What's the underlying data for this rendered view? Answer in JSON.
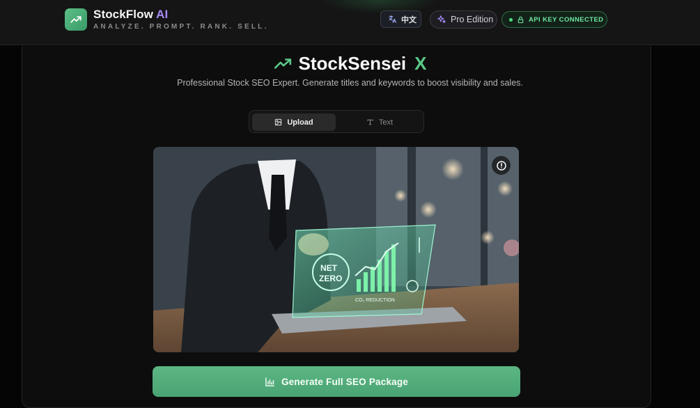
{
  "header": {
    "brand_name": "StockFlow",
    "brand_ai": "AI",
    "tagline": "ANALYZE. PROMPT. RANK. SELL.",
    "language_label": "中文",
    "edition_label": "Pro Edition",
    "api_status_label": "API KEY CONNECTED"
  },
  "main": {
    "title": "StockSensei",
    "title_suffix": "X",
    "subtitle": "Professional Stock SEO Expert. Generate titles and keywords to boost visibility and sales.",
    "tabs": [
      {
        "label": "Upload",
        "active": true,
        "icon": "image-icon"
      },
      {
        "label": "Text",
        "active": false,
        "icon": "type-icon"
      }
    ],
    "image_overlay_text": [
      "NET",
      "ZERO",
      "CO₂ REDUCTION"
    ],
    "generate_button_label": "Generate Full SEO Package"
  },
  "colors": {
    "accent_green": "#5bc886",
    "brand_purple": "#a78bfa",
    "background": "#050505"
  }
}
